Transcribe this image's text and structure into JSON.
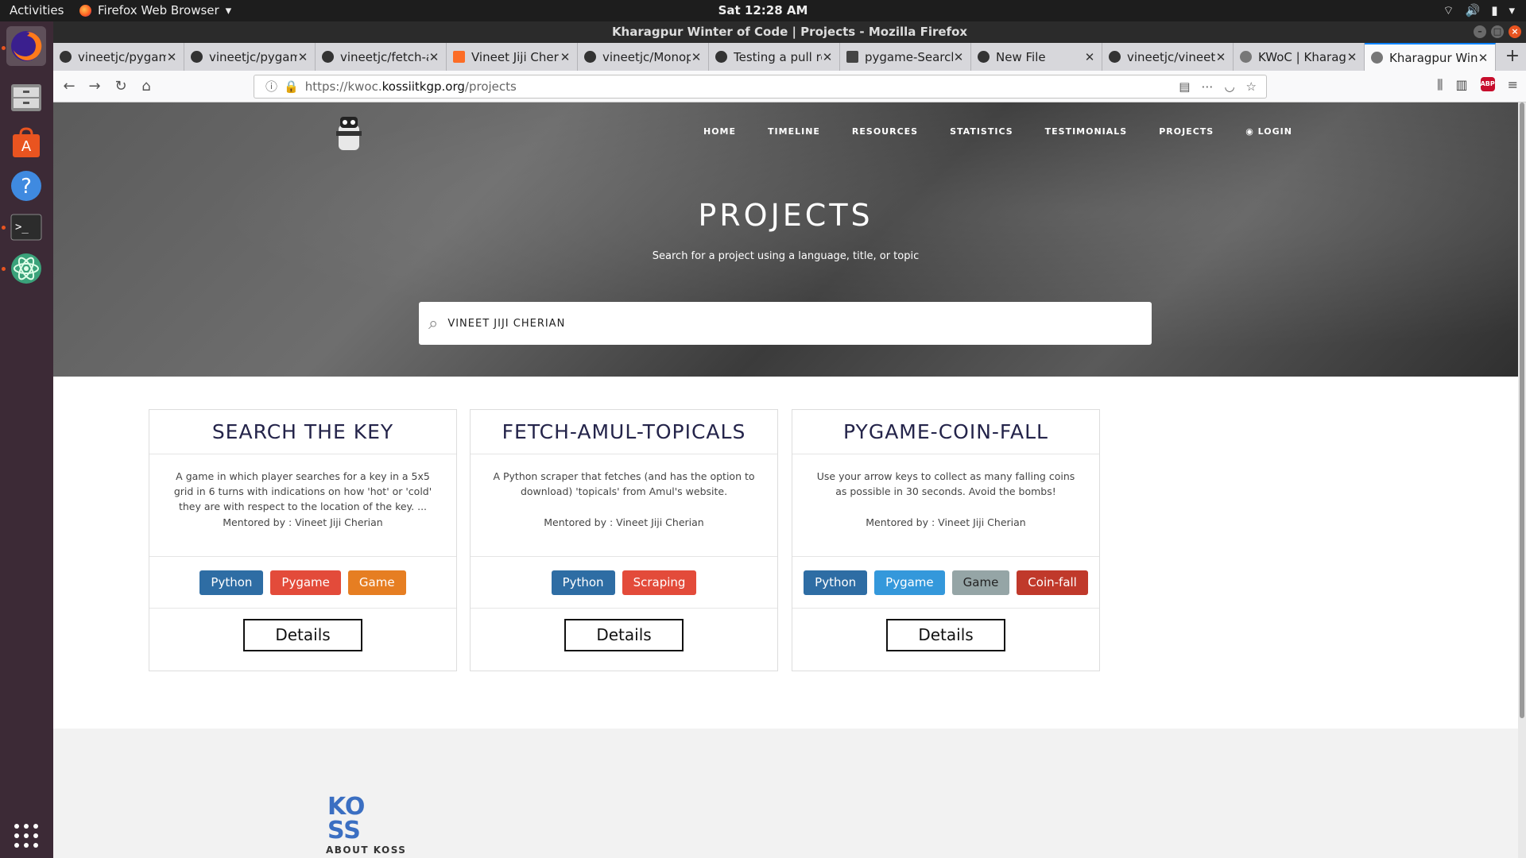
{
  "system": {
    "activities": "Activities",
    "app_name": "Firefox Web Browser",
    "clock": "Sat 12:28 AM"
  },
  "window": {
    "title": "Kharagpur Winter of Code | Projects - Mozilla Firefox"
  },
  "tabs": [
    {
      "label": "vineetjc/pygame-"
    },
    {
      "label": "vineetjc/pygame-"
    },
    {
      "label": "vineetjc/fetch-am"
    },
    {
      "label": "Vineet Jiji Cheria"
    },
    {
      "label": "vineetjc/Monopo"
    },
    {
      "label": "Testing a pull re"
    },
    {
      "label": "pygame-SearchTh"
    },
    {
      "label": "New File"
    },
    {
      "label": "vineetjc/vineetjc"
    },
    {
      "label": "KWoC | Kharagpu"
    },
    {
      "label": "Kharagpur Wint"
    }
  ],
  "url": {
    "prefix": "https://kwoc.",
    "domain": "kossiitkgp.org",
    "path": "/projects"
  },
  "site": {
    "nav": [
      "HOME",
      "TIMELINE",
      "RESOURCES",
      "STATISTICS",
      "TESTIMONIALS",
      "PROJECTS",
      "LOGIN"
    ],
    "title": "PROJECTS",
    "subtitle": "Search for a project using a language, title, or topic",
    "search_value": "VINEET JIJI CHERIAN"
  },
  "cards": [
    {
      "title": "SEARCH THE KEY",
      "description": "A game in which player searches for a key in a 5x5 grid in 6 turns with indications on how 'hot' or 'cold' they are with respect to the location of the key. ...",
      "mentor": "Mentored by : Vineet Jiji Cherian",
      "tags": [
        {
          "label": "Python",
          "color": "#2e6da4"
        },
        {
          "label": "Pygame",
          "color": "#e34b3a"
        },
        {
          "label": "Game",
          "color": "#e67e22"
        }
      ],
      "button": "Details"
    },
    {
      "title": "FETCH-AMUL-TOPICALS",
      "description": "A Python scraper that fetches (and has the option to download) 'topicals' from Amul's website.",
      "mentor": "Mentored by : Vineet Jiji Cherian",
      "tags": [
        {
          "label": "Python",
          "color": "#2e6da4"
        },
        {
          "label": "Scraping",
          "color": "#e34b3a"
        }
      ],
      "button": "Details"
    },
    {
      "title": "PYGAME-COIN-FALL",
      "description": "Use your arrow keys to collect as many falling coins as possible in 30 seconds. Avoid the bombs!",
      "mentor": "Mentored by : Vineet Jiji Cherian",
      "tags": [
        {
          "label": "Python",
          "color": "#2e6da4"
        },
        {
          "label": "Pygame",
          "color": "#3498db"
        },
        {
          "label": "Game",
          "color": "#95a5a6"
        },
        {
          "label": "Coin-fall",
          "color": "#c0392b"
        }
      ],
      "button": "Details"
    }
  ],
  "footer": {
    "about": "ABOUT KOSS"
  }
}
